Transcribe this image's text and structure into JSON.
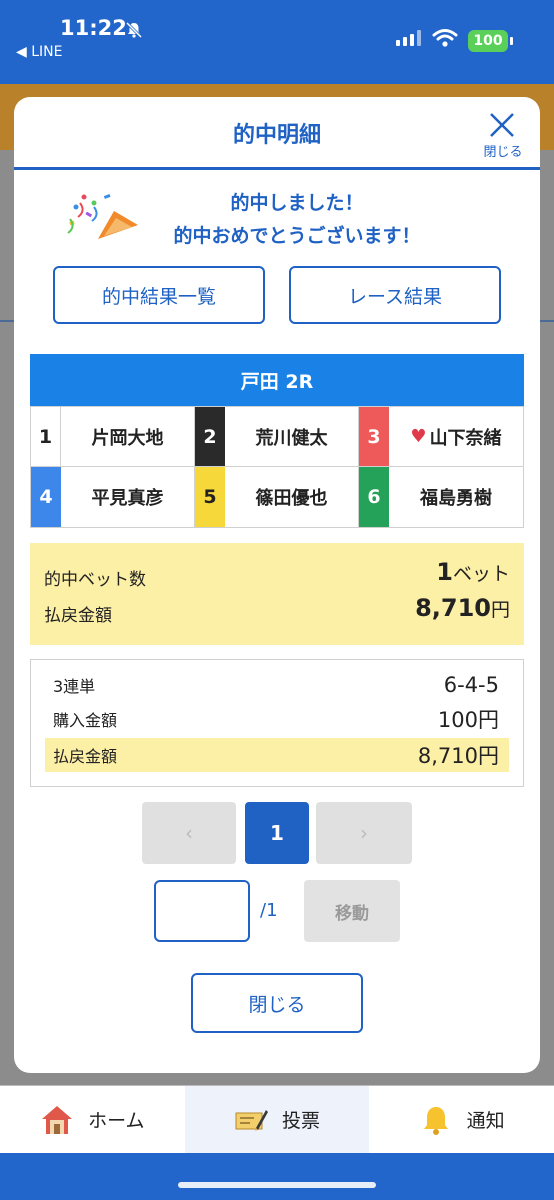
{
  "status_bar": {
    "time": "11:22",
    "back_app": "◀ LINE",
    "battery": "100"
  },
  "modal": {
    "title": "的中明細",
    "close_label": "閉じる",
    "congrats_line1": "的中しました！",
    "congrats_line2": "的中おめでとうございます！",
    "hit_list_button": "的中結果一覧",
    "race_result_button": "レース結果",
    "race_name": "戸田 2R",
    "racers": [
      {
        "num": "1",
        "name": "片岡大地",
        "color": "#ffffff",
        "num_color": "#222222",
        "favorite": false
      },
      {
        "num": "2",
        "name": "荒川健太",
        "color": "#2a2a2a",
        "num_color": "#ffffff",
        "favorite": false
      },
      {
        "num": "3",
        "name": "山下奈緒",
        "color": "#ee5a5a",
        "num_color": "#ffffff",
        "favorite": true
      },
      {
        "num": "4",
        "name": "平見真彦",
        "color": "#3d86ea",
        "num_color": "#ffffff",
        "favorite": false
      },
      {
        "num": "5",
        "name": "篠田優也",
        "color": "#f7d83a",
        "num_color": "#222222",
        "favorite": false
      },
      {
        "num": "6",
        "name": "福島勇樹",
        "color": "#25a25a",
        "num_color": "#ffffff",
        "favorite": false
      }
    ],
    "summary": {
      "bet_count_label": "的中ベット数",
      "bet_count_value": "1",
      "bet_count_unit": "ベット",
      "payout_label": "払戻金額",
      "payout_value": "8,710",
      "payout_unit": "円"
    },
    "detail": {
      "bet_type_label": "3連単",
      "bet_type_value": "6-4-5",
      "purchase_label": "購入金額",
      "purchase_value": "100円",
      "payout_label": "払戻金額",
      "payout_value": "8,710円"
    },
    "pagination": {
      "prev": "‹",
      "current": "1",
      "next": "›",
      "page_input_value": "",
      "total": "/1",
      "move_button": "移動"
    },
    "close_button": "閉じる"
  },
  "tabbar": {
    "tabs": [
      {
        "label": "ホーム",
        "icon": "home-icon"
      },
      {
        "label": "投票",
        "icon": "ticket-icon"
      },
      {
        "label": "通知",
        "icon": "bell-icon"
      }
    ],
    "active_tab": "投票"
  },
  "colors": {
    "primary": "#1f62c4",
    "race_header": "#1a82e6",
    "highlight": "#fcefa6",
    "status_bar": "#2266cc"
  }
}
